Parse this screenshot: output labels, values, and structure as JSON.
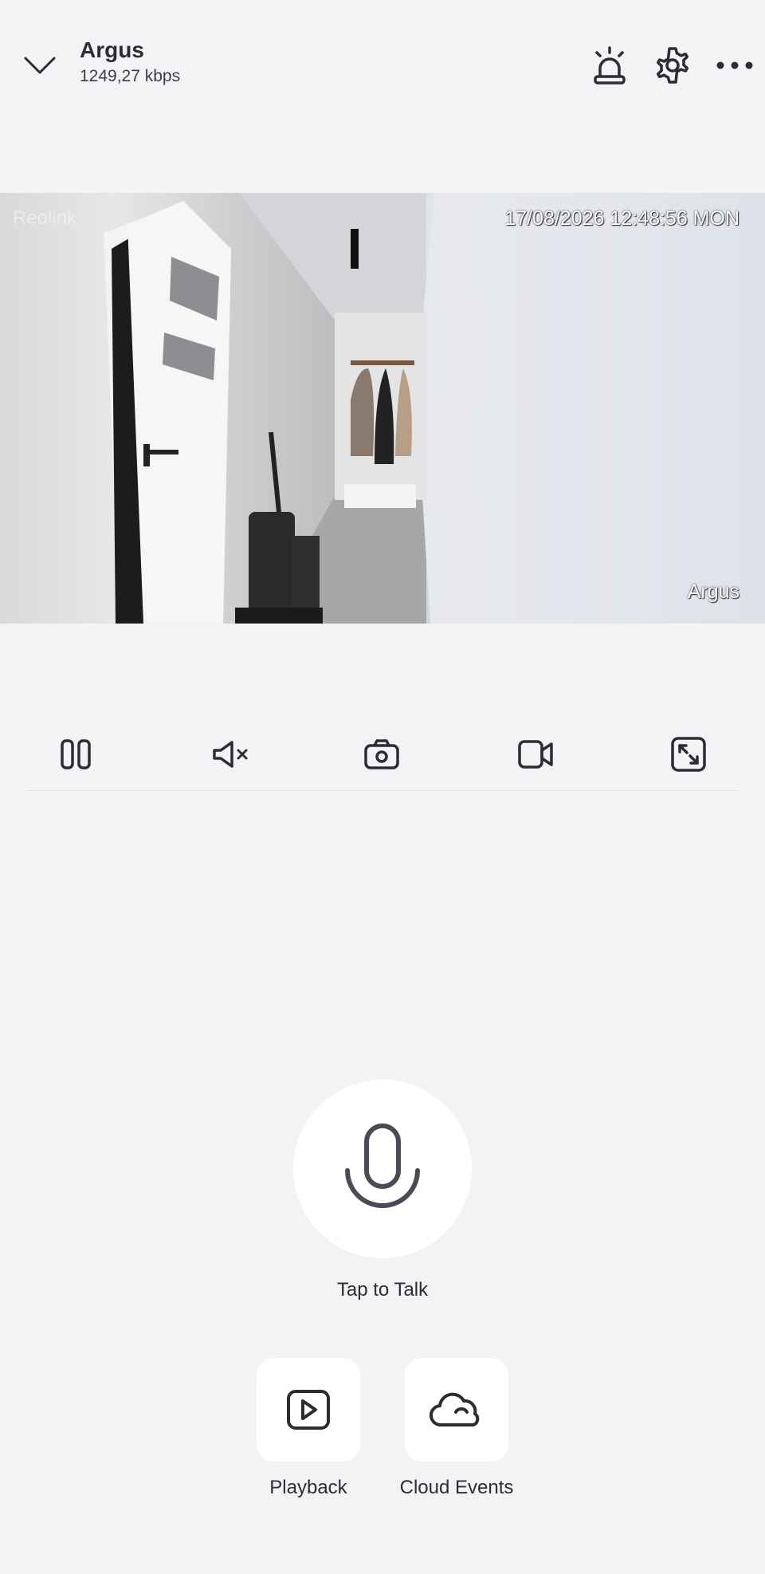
{
  "header": {
    "title": "Argus",
    "bitrate": "1249,27 kbps",
    "icons": [
      "chevron-down-icon",
      "siren-icon",
      "gear-icon",
      "more-icon"
    ]
  },
  "video": {
    "watermark": "Reolink",
    "timestamp": "17/08/2026 12:48:56 MON",
    "camera_label": "Argus"
  },
  "controls": [
    "pause-icon",
    "mute-icon",
    "snapshot-icon",
    "record-icon",
    "fullscreen-icon"
  ],
  "talk": {
    "label": "Tap to Talk"
  },
  "shortcuts": [
    {
      "label": "Playback",
      "icon": "playback-icon"
    },
    {
      "label": "Cloud Events",
      "icon": "cloud-icon"
    }
  ],
  "colors": {
    "background": "#f2f3f5",
    "icon": "#2b2d33",
    "tile": "#ffffff"
  }
}
